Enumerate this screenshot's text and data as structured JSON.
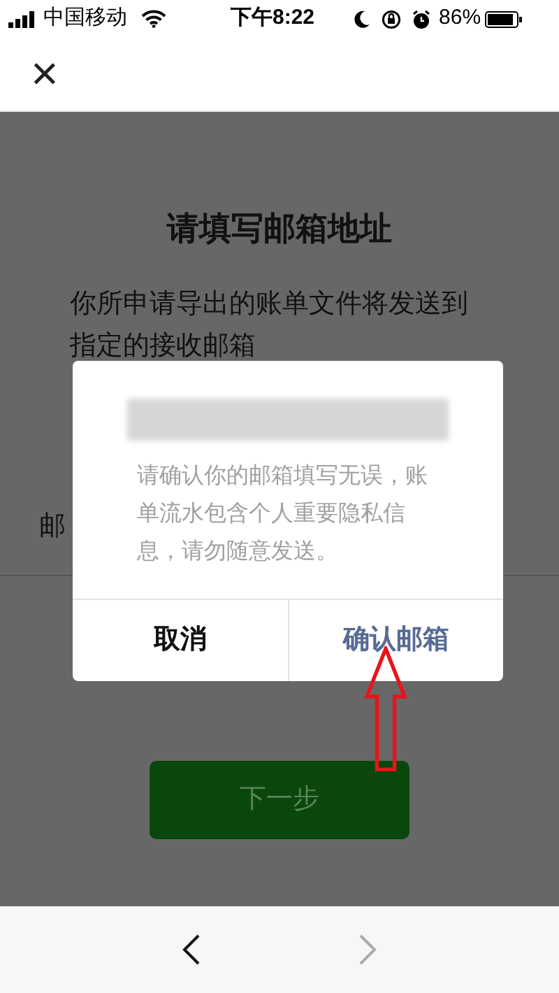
{
  "status_bar": {
    "carrier": "中国移动",
    "time": "下午8:22",
    "battery": "86%"
  },
  "nav": {
    "close": "×"
  },
  "page": {
    "title": "请填写邮箱地址",
    "description": "你所申请导出的账单文件将发送到指定的接收邮箱",
    "field_label": "邮",
    "next_button": "下一步"
  },
  "dialog": {
    "email_redacted": true,
    "message": "请确认你的邮箱填写无误，账单流水包含个人重要隐私信息，请勿随意发送。",
    "buttons": [
      {
        "label": "取消",
        "kind": "cancel"
      },
      {
        "label": "确认邮箱",
        "kind": "confirm"
      }
    ]
  },
  "annotation": {
    "arrow": true
  },
  "toolbar": {
    "back_enabled": true,
    "forward_enabled": false
  }
}
